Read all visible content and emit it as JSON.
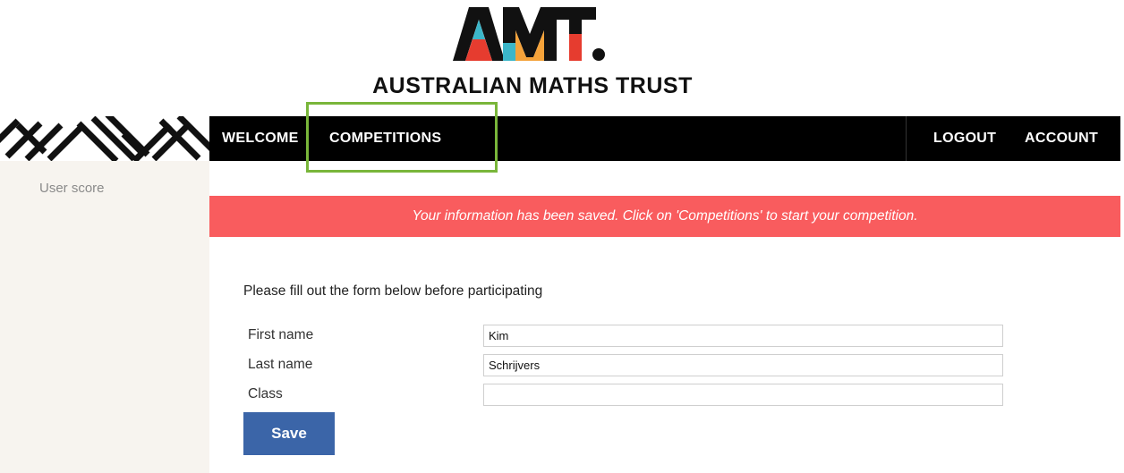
{
  "header": {
    "logo_text": "AMT.",
    "org_name": "AUSTRALIAN MATHS TRUST"
  },
  "nav": {
    "welcome": "WELCOME",
    "competitions": "COMPETITIONS",
    "logout": "LOGOUT",
    "account": "ACCOUNT",
    "highlight_color": "#79b63a"
  },
  "sidebar": {
    "items": [
      {
        "label": "User score"
      }
    ]
  },
  "banner": {
    "message": "Your information has been saved. Click on 'Competitions' to start your competition.",
    "color": "#f95c5e"
  },
  "form": {
    "intro": "Please fill out the form below before participating",
    "fields": [
      {
        "label": "First name",
        "value": "Kim"
      },
      {
        "label": "Last name",
        "value": "Schrijvers"
      },
      {
        "label": "Class",
        "value": ""
      }
    ],
    "save_label": "Save",
    "save_color": "#3b65a8"
  }
}
